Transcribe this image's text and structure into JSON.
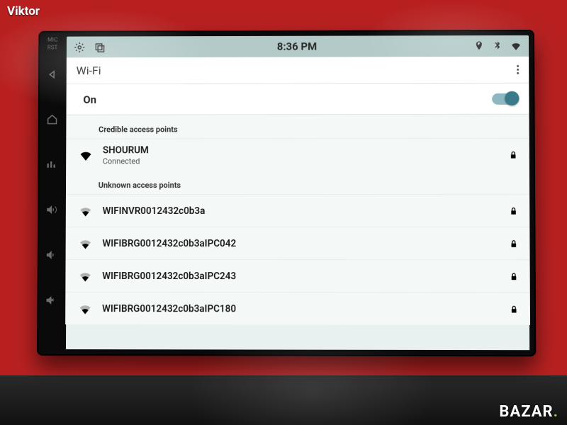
{
  "watermarks": {
    "top_left": "Viktor",
    "bottom_right": "BAZAR"
  },
  "bezel": {
    "labels": [
      "MIC",
      "RST"
    ]
  },
  "statusbar": {
    "time": "8:36 PM"
  },
  "title": "Wi-Fi",
  "toggle": {
    "label": "On",
    "state": "on"
  },
  "sections": {
    "credible": {
      "header": "Credible access points",
      "items": [
        {
          "name": "SHOURUM",
          "sub": "Connected",
          "locked": true,
          "signal": "full"
        }
      ]
    },
    "unknown": {
      "header": "Unknown access points",
      "items": [
        {
          "name": "WIFINVR0012432c0b3a",
          "locked": true,
          "signal": "mid"
        },
        {
          "name": "WIFIBRG0012432c0b3aIPC042",
          "locked": true,
          "signal": "mid"
        },
        {
          "name": "WIFIBRG0012432c0b3aIPC243",
          "locked": true,
          "signal": "mid"
        },
        {
          "name": "WIFIBRG0012432c0b3aIPC180",
          "locked": true,
          "signal": "mid"
        }
      ]
    }
  }
}
